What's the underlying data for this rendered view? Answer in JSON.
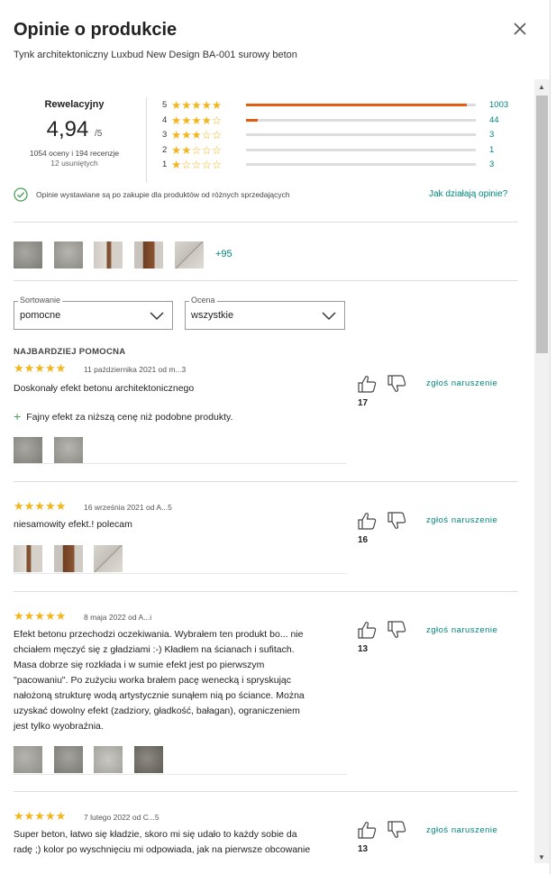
{
  "header": {
    "title": "Opinie o produkcie",
    "product_name": "Tynk architektoniczny Luxbud New Design BA-001 surowy beton"
  },
  "summary": {
    "label": "Rewelacyjny",
    "score": "4,94",
    "score_suffix": "/5",
    "counts": "1054 oceny i 194 recenzje",
    "removed": "12 usuniętych",
    "distribution": [
      {
        "stars": "5",
        "star_glyphs": "★★★★★",
        "count": "1003",
        "fraction": 0.96
      },
      {
        "stars": "4",
        "star_glyphs": "★★★★☆",
        "count": "44",
        "fraction": 0.05
      },
      {
        "stars": "3",
        "star_glyphs": "★★★☆☆",
        "count": "3",
        "fraction": 0.0
      },
      {
        "stars": "2",
        "star_glyphs": "★★☆☆☆",
        "count": "1",
        "fraction": 0.0
      },
      {
        "stars": "1",
        "star_glyphs": "★☆☆☆☆",
        "count": "3",
        "fraction": 0.0
      }
    ],
    "verified_text": "Opinie wystawiane są po zakupie dla produktów od różnych sprzedających",
    "how_link": "Jak działają opinie?"
  },
  "gallery": {
    "more_label": "+95",
    "thumbnails": [
      "concrete-wall-photo",
      "concrete-wall-photo",
      "hallway-photo",
      "door-photo",
      "wall-panels-photo"
    ]
  },
  "filters": {
    "sort": {
      "label": "Sortowanie",
      "value": "pomocne"
    },
    "rating": {
      "label": "Ocena",
      "value": "wszystkie"
    }
  },
  "reviews_section": {
    "best_label": "NAJBARDZIEJ POMOCNA"
  },
  "reviews": [
    {
      "stars": "★★★★★",
      "date": "11 października 2021 od m...3",
      "text": "Doskonały efekt betonu architektonicznego",
      "pro": "Fajny efekt za niższą cenę niż podobne produkty.",
      "votes": "17",
      "report": "zgłoś naruszenie"
    },
    {
      "stars": "★★★★★",
      "date": "16 września 2021 od A...5",
      "text": "niesamowity efekt.! polecam",
      "votes": "16",
      "report": "zgłoś naruszenie"
    },
    {
      "stars": "★★★★★",
      "date": "8 maja 2022 od A...i",
      "text_lines": [
        "Efekt betonu przechodzi oczekiwania. Wybrałem ten produkt bo... nie",
        "chciałem męczyć się z gładziami :-) Kładłem na ścianach i sufitach.",
        "Masa dobrze się rozkłada i w sumie efekt jest po pierwszym",
        "\"pacowaniu\". Po zużyciu worka brałem pacę wenecką i spryskując",
        "nałożoną strukturę wodą artystycznie sunąłem nią po ściance. Można",
        "uzyskać dowolny efekt (zadziory, gładkość, bałagan), ograniczeniem",
        "jest tylko wyobraźnia."
      ],
      "votes": "13",
      "report": "zgłoś naruszenie"
    },
    {
      "stars": "★★★★★",
      "date": "7 lutego 2022 od C...5",
      "text_lines": [
        "Super beton, łatwo się kładzie, skoro mi się udało to każdy sobie da",
        "radę ;) kolor po wyschnięciu mi odpowiada, jak na pierwsze obcowanie"
      ],
      "votes": "13",
      "report": "zgłoś naruszenie"
    }
  ],
  "colors": {
    "accent": "#00857a",
    "bar_fill": "#e35d10",
    "star": "#f3b51b",
    "verified": "#4aa15a"
  }
}
